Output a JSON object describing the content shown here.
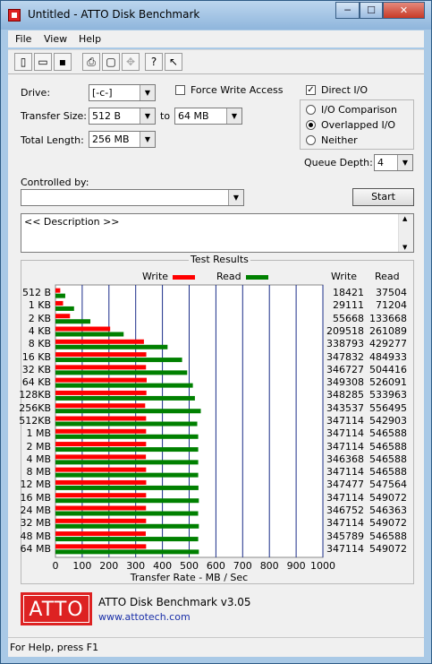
{
  "window": {
    "title": "Untitled - ATTO Disk Benchmark",
    "minimize": "─",
    "maximize": "☐",
    "close": "✕"
  },
  "menu": [
    "File",
    "View",
    "Help"
  ],
  "toolbar": [
    "new-icon",
    "open-icon",
    "save-icon",
    "print-icon",
    "print-preview-icon",
    "move-icon",
    "help-icon",
    "context-help-icon"
  ],
  "form": {
    "drive_label": "Drive:",
    "drive_value": "[-c-]",
    "force_write_label": "Force Write Access",
    "force_write_checked": false,
    "direct_io_label": "Direct I/O",
    "direct_io_checked": true,
    "transfer_size_label": "Transfer Size:",
    "transfer_from": "512 B",
    "to_label": "to",
    "transfer_to": "64 MB",
    "total_length_label": "Total Length:",
    "total_length": "256 MB",
    "io_comparison_label": "I/O Comparison",
    "overlapped_io_label": "Overlapped I/O",
    "neither_label": "Neither",
    "io_mode_selected": "Overlapped I/O",
    "queue_depth_label": "Queue Depth:",
    "queue_depth": "4",
    "controlled_by_label": "Controlled by:",
    "controlled_by_value": "",
    "start_label": "Start",
    "description": "<< Description >>"
  },
  "results": {
    "title": "Test Results",
    "legend_write": "Write",
    "legend_read": "Read",
    "col_write": "Write",
    "col_read": "Read",
    "xlabel": "Transfer Rate - MB / Sec",
    "colors": {
      "write": "#ff0000",
      "read": "#008000"
    }
  },
  "chart_data": {
    "type": "bar",
    "orientation": "horizontal",
    "xlabel": "Transfer Rate - MB / Sec",
    "xlim": [
      0,
      1000
    ],
    "xticks": [
      0,
      100,
      200,
      300,
      400,
      500,
      600,
      700,
      800,
      900,
      1000
    ],
    "categories": [
      "512 B",
      "1 KB",
      "2 KB",
      "4 KB",
      "8 KB",
      "16 KB",
      "32 KB",
      "64 KB",
      "128KB",
      "256KB",
      "512KB",
      "1 MB",
      "2 MB",
      "4 MB",
      "8 MB",
      "12 MB",
      "16 MB",
      "24 MB",
      "32 MB",
      "48 MB",
      "64 MB"
    ],
    "series": [
      {
        "name": "Write",
        "color": "#ff0000",
        "values": [
          18421,
          29111,
          55668,
          209518,
          338793,
          347832,
          346727,
          349308,
          348285,
          343537,
          347114,
          347114,
          347114,
          346368,
          347114,
          347477,
          347114,
          346752,
          347114,
          345789,
          347114
        ]
      },
      {
        "name": "Read",
        "color": "#008000",
        "values": [
          37504,
          71204,
          133668,
          261089,
          429277,
          484933,
          504416,
          526091,
          533963,
          556495,
          542903,
          546588,
          546588,
          546588,
          546588,
          547564,
          549072,
          546363,
          549072,
          546588,
          549072
        ]
      }
    ]
  },
  "footer": {
    "logo": "ATTO",
    "app_name": "ATTO Disk Benchmark v3.05",
    "url": "www.attotech.com"
  },
  "status": "For Help, press F1"
}
